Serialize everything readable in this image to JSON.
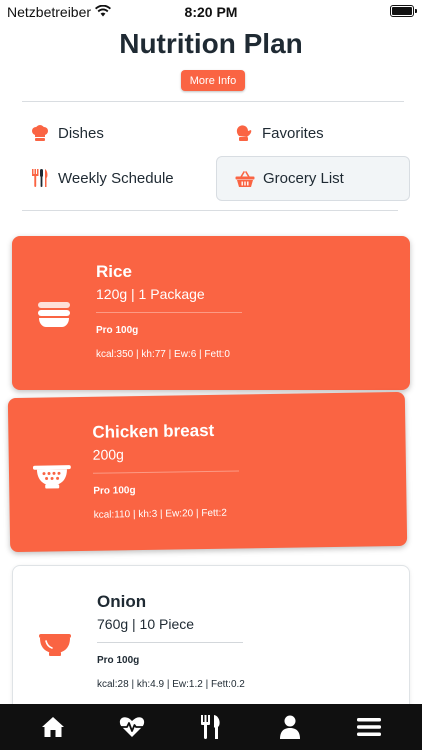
{
  "status_bar": {
    "carrier": "Netzbetreiber",
    "time": "8:20 PM"
  },
  "header": {
    "title": "Nutrition Plan",
    "more_info_label": "More Info"
  },
  "menu": {
    "dishes": "Dishes",
    "favorites": "Favorites",
    "weekly_schedule": "Weekly Schedule",
    "grocery_list": "Grocery List"
  },
  "items": [
    {
      "name": "Rice",
      "amount": "120g | 1 Package",
      "per": "Pro 100g",
      "nutrition": "kcal:350 | kh:77 | Ew:6 | Fett:0",
      "icon": "bowl-stack-icon"
    },
    {
      "name": "Chicken breast",
      "amount": "200g",
      "per": "Pro 100g",
      "nutrition": "kcal:110 | kh:3 | Ew:20 | Fett:2",
      "icon": "colander-icon"
    },
    {
      "name": "Onion",
      "amount": "760g | 10 Piece",
      "per": "Pro 100g",
      "nutrition": "kcal:28 | kh:4.9 | Ew:1.2 | Fett:0.2",
      "icon": "bowl-icon"
    }
  ],
  "colors": {
    "accent": "#fa6443",
    "text": "#1f2a33",
    "tab_bar": "#101010"
  },
  "tab_bar": [
    "home-icon",
    "heartbeat-icon",
    "utensils-icon",
    "user-icon",
    "menu-icon"
  ]
}
